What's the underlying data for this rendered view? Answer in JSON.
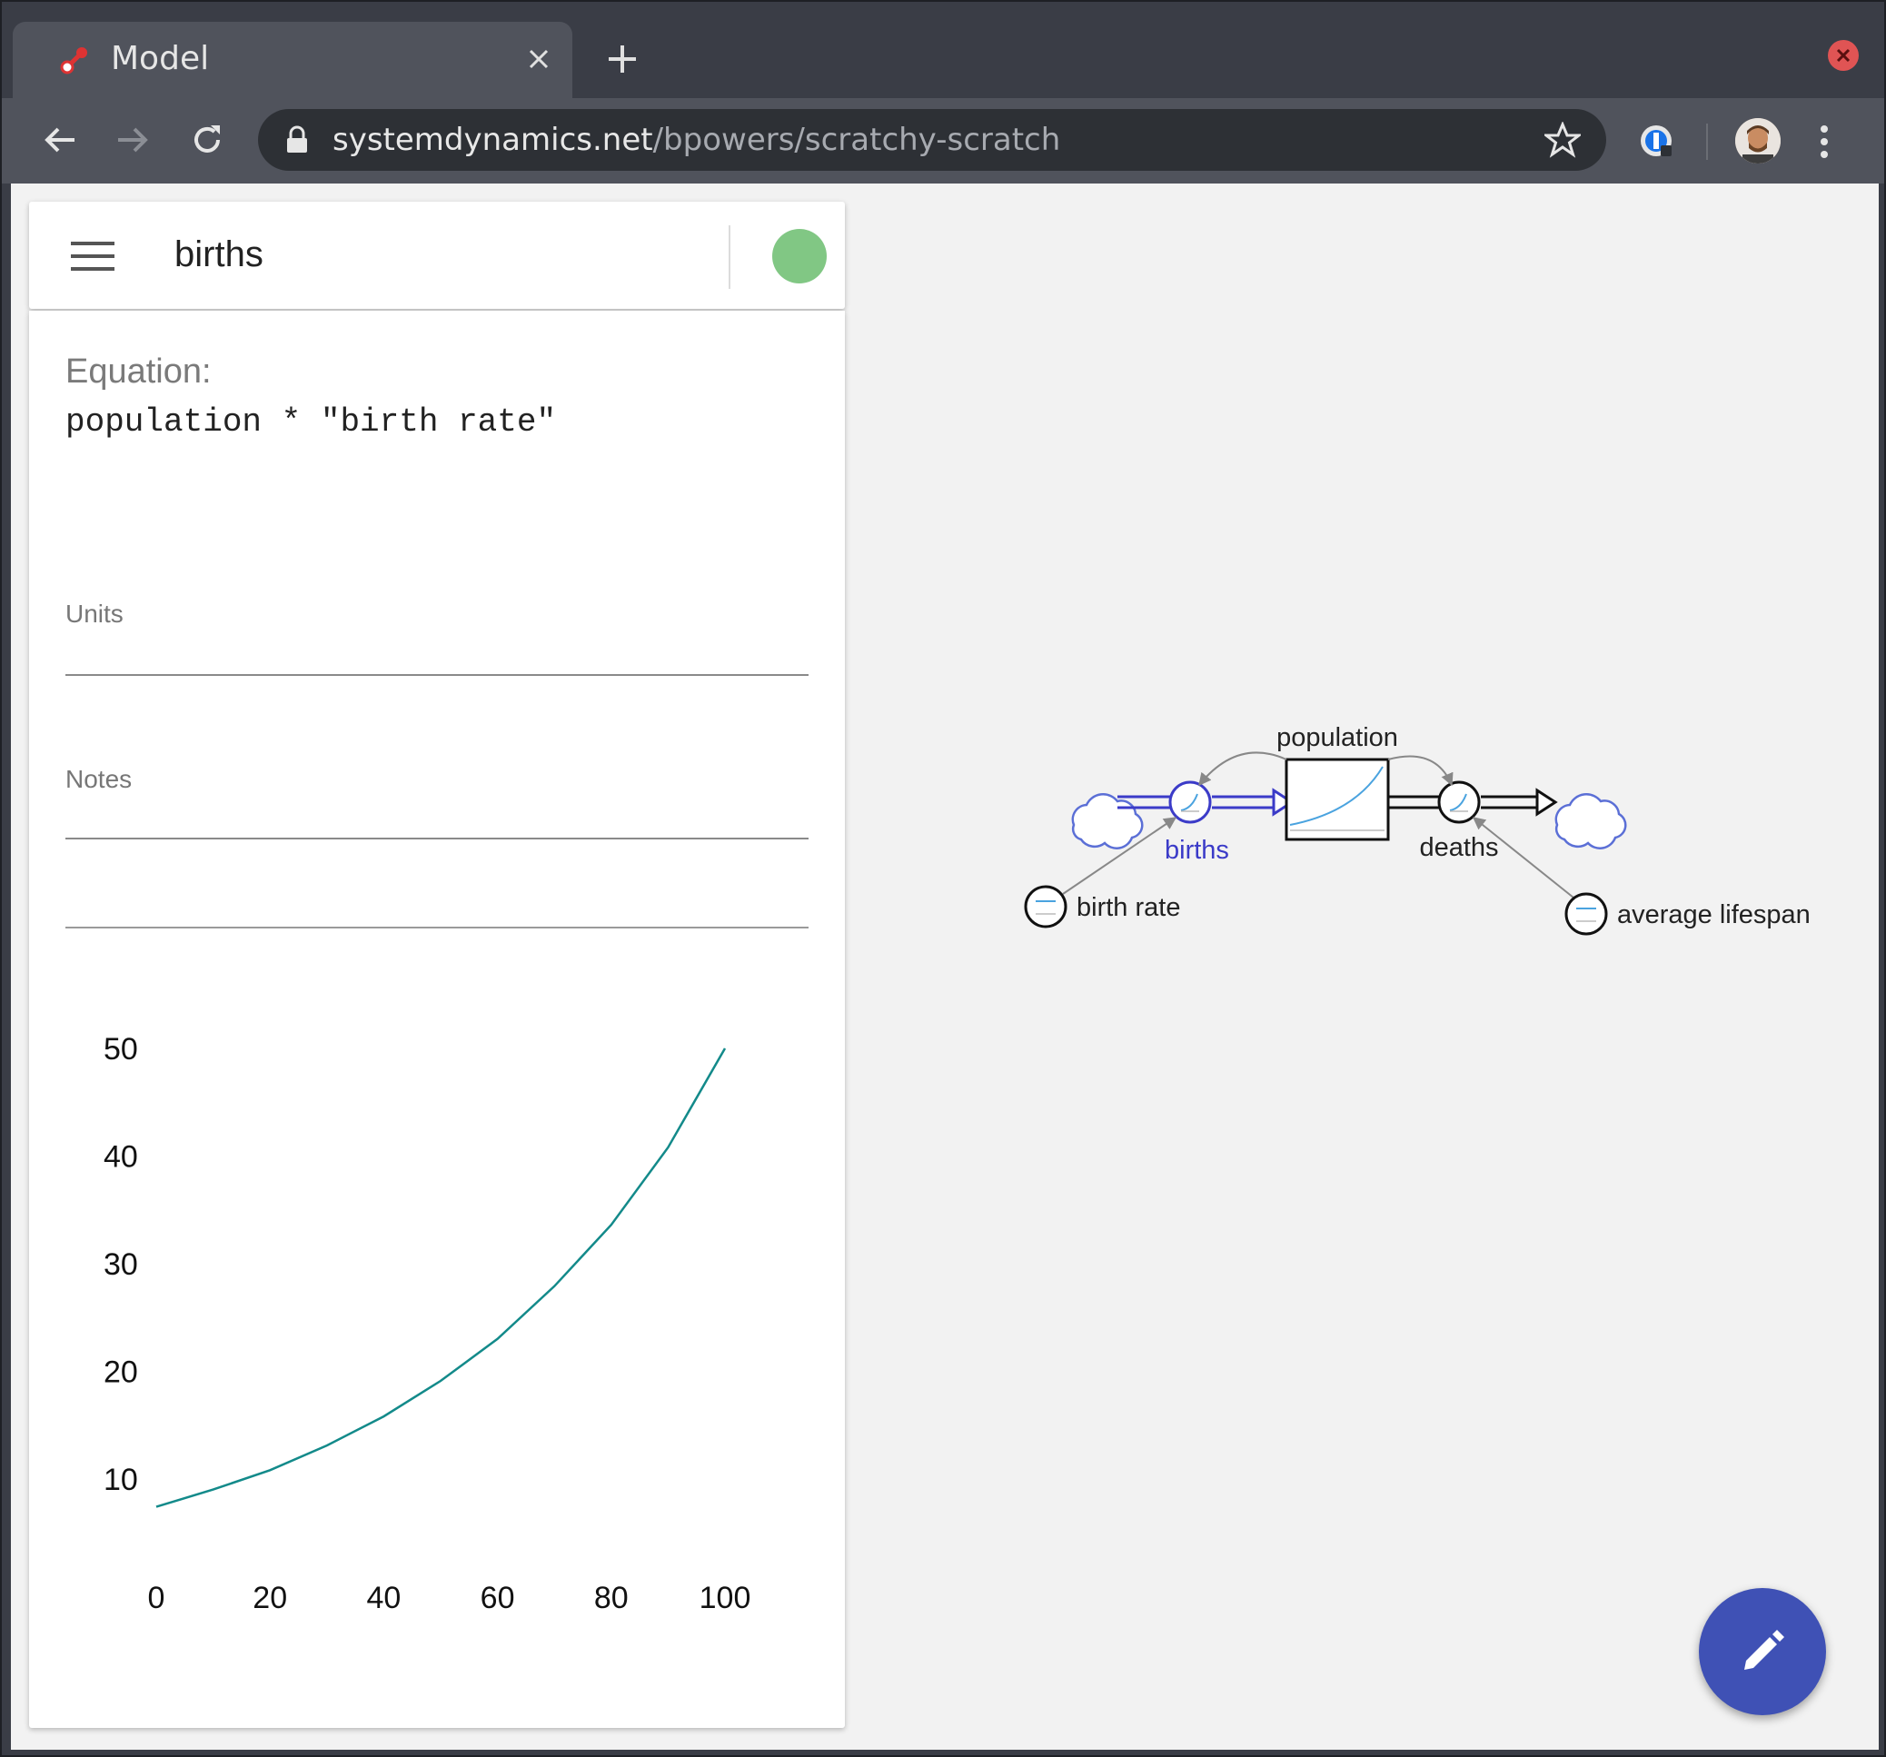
{
  "browser": {
    "tab_title": "Model",
    "url_host": "systemdynamics.net",
    "url_path": "/bpowers/scratchy-scratch"
  },
  "panel": {
    "variable_name": "births",
    "status_color": "#81c784",
    "equation_label": "Equation:",
    "equation": "population * \"birth rate\"",
    "units_label": "Units",
    "units_value": "",
    "notes_label": "Notes",
    "notes_value": ""
  },
  "chart_data": {
    "type": "line",
    "title": "",
    "xlabel": "",
    "ylabel": "",
    "x_ticks": [
      "0",
      "20",
      "40",
      "60",
      "80",
      "100"
    ],
    "y_ticks": [
      "10",
      "20",
      "30",
      "40",
      "50"
    ],
    "xlim": [
      0,
      100
    ],
    "ylim": [
      5,
      50
    ],
    "line_color": "#138a8a",
    "series": [
      {
        "x": [
          0,
          10,
          20,
          30,
          40,
          50,
          60,
          70,
          80,
          90,
          100
        ],
        "values": [
          7.4,
          9.0,
          10.8,
          13.1,
          15.8,
          19.1,
          23.0,
          27.9,
          33.6,
          40.8,
          50.0
        ]
      }
    ]
  },
  "diagram": {
    "stock_label": "population",
    "inflow_label": "births",
    "outflow_label": "deaths",
    "aux_birth_rate": "birth rate",
    "aux_lifespan": "average lifespan",
    "selected_color": "#3b3bc8",
    "cloud_color": "#5b6fd6"
  },
  "fab": {
    "icon": "edit-pencil-icon"
  }
}
